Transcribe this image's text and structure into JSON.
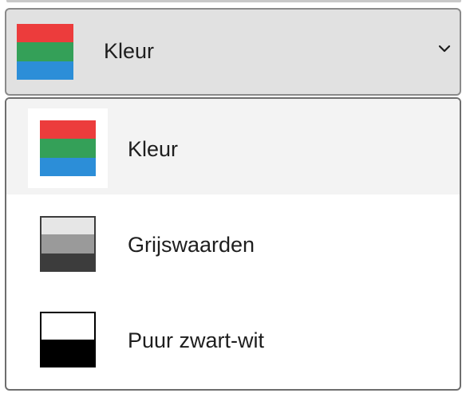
{
  "select": {
    "selected_label": "Kleur",
    "selected_icon": "color-mode-icon"
  },
  "options": [
    {
      "label": "Kleur",
      "icon": "color-mode-icon",
      "selected": true
    },
    {
      "label": "Grijswaarden",
      "icon": "grayscale-mode-icon",
      "selected": false
    },
    {
      "label": "Puur zwart-wit",
      "icon": "black-white-mode-icon",
      "selected": false
    }
  ],
  "colors": {
    "red": "#ec3c3c",
    "green": "#34a058",
    "blue": "#2c8ed8",
    "gray_light": "#e6e6e6",
    "gray_mid": "#9a9a9a",
    "gray_dark": "#3c3c3c",
    "black": "#000000",
    "selected_bg": "#f3f3f3",
    "control_bg": "#e1e1e1"
  }
}
